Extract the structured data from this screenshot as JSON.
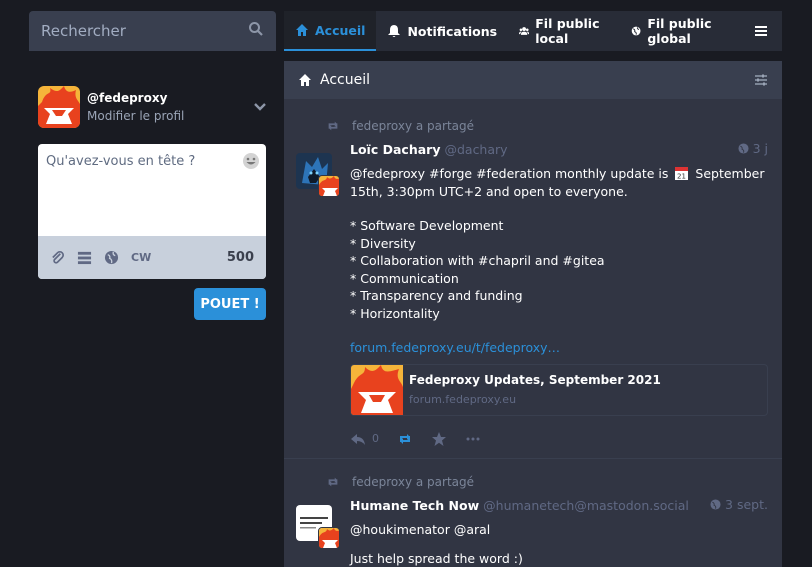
{
  "search": {
    "placeholder": "Rechercher"
  },
  "profile": {
    "handle": "@fedeproxy",
    "edit_label": "Modifier le profil"
  },
  "compose": {
    "placeholder": "Qu'avez-vous en tête ?",
    "cw_label": "CW",
    "char_count": "500",
    "submit_label": "POUET !"
  },
  "nav": {
    "tabs": [
      {
        "label": "Accueil",
        "icon": "home-icon",
        "active": true
      },
      {
        "label": "Notifications",
        "icon": "bell-icon"
      },
      {
        "label": "Fil public local",
        "icon": "users-icon"
      },
      {
        "label": "Fil public global",
        "icon": "globe-icon"
      }
    ],
    "menu_icon": "hamburger-icon"
  },
  "column": {
    "title": "Accueil"
  },
  "statuses": [
    {
      "boost_text": "fedeproxy a partagé",
      "display_name": "Loïc Dachary",
      "handle": "@dachary",
      "time": "3 j",
      "text_line1_a": "@fedeproxy #forge #federation monthly update is",
      "text_line1_b": "September 15th, 3:30pm UTC+2 and open to everyone.",
      "bullets": [
        "* Software Development",
        "* Diversity",
        "* Collaboration with #chapril and #gitea",
        "* Communication",
        "* Transparency and funding",
        "* Horizontality"
      ],
      "link": "forum.fedeproxy.eu/t/fedeproxy…",
      "card_title": "Fedeproxy Updates, September 2021",
      "card_url": "forum.fedeproxy.eu",
      "reply_count": "0"
    },
    {
      "boost_text": "fedeproxy a partagé",
      "display_name": "Humane Tech Now",
      "handle": "@humanetech@mastodon.social",
      "time": "3 sept.",
      "text_line1": "@houkimenator @aral",
      "text_line2": "Just help spread the word :)"
    }
  ],
  "colors": {
    "accent": "#2b90d9",
    "background": "#191b22",
    "panel": "#313543",
    "header": "#393f4f"
  }
}
